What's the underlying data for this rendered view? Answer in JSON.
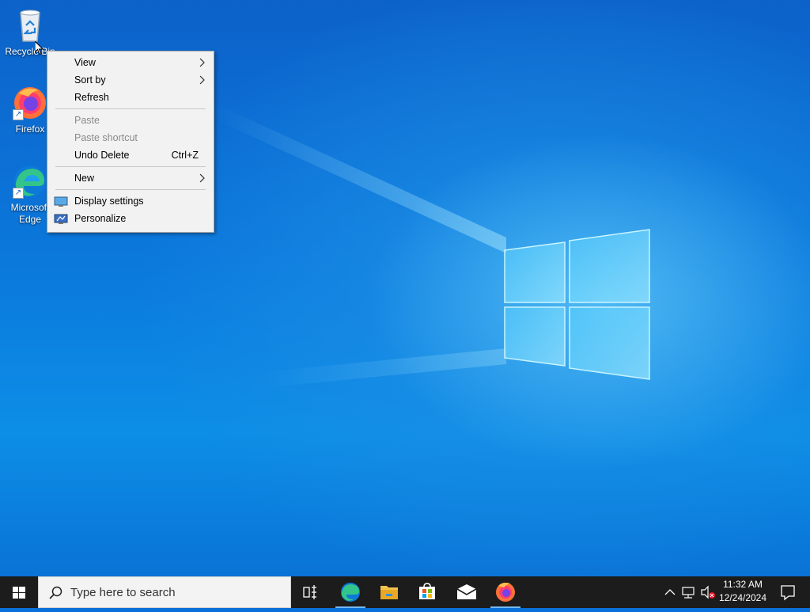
{
  "desktop": {
    "icons": [
      {
        "name": "recycle-bin",
        "label": "Recycle Bin"
      },
      {
        "name": "firefox",
        "label": "Firefox"
      },
      {
        "name": "microsoft-edge",
        "label": "Microsoft Edge"
      }
    ]
  },
  "context_menu": {
    "items": [
      {
        "label": "View",
        "submenu": true,
        "enabled": true
      },
      {
        "label": "Sort by",
        "submenu": true,
        "enabled": true
      },
      {
        "label": "Refresh",
        "enabled": true
      },
      {
        "label": "Paste",
        "enabled": false
      },
      {
        "label": "Paste shortcut",
        "enabled": false
      },
      {
        "label": "Undo Delete",
        "shortcut": "Ctrl+Z",
        "enabled": true
      },
      {
        "label": "New",
        "submenu": true,
        "enabled": true
      },
      {
        "label": "Display settings",
        "icon": "display-icon",
        "enabled": true
      },
      {
        "label": "Personalize",
        "icon": "personalize-icon",
        "enabled": true
      }
    ]
  },
  "taskbar": {
    "search_placeholder": "Type here to search",
    "pinned": [
      "task-view",
      "microsoft-edge",
      "file-explorer",
      "microsoft-store",
      "mail",
      "firefox"
    ],
    "tray": {
      "time": "11:32 AM",
      "date": "12/24/2024"
    }
  },
  "colors": {
    "taskbar": "#1c1c1c",
    "desktop_blue": "#0b78dc",
    "accent": "#76b9ed"
  }
}
